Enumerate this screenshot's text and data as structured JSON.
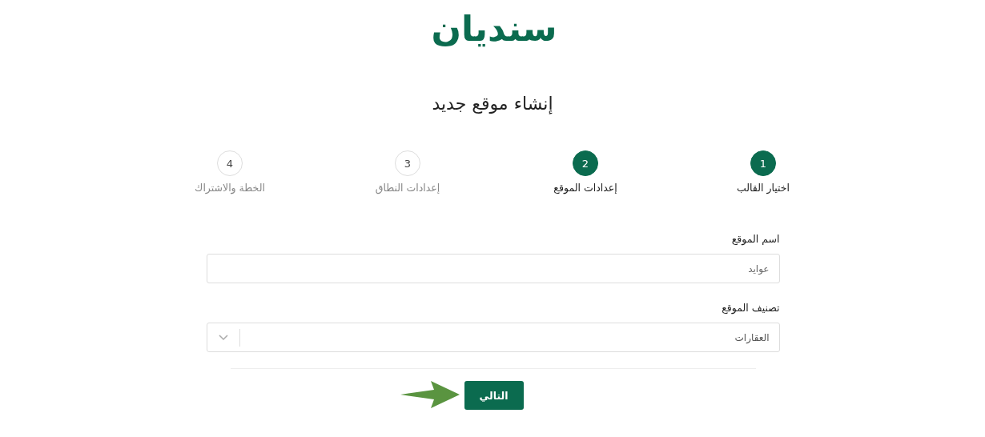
{
  "logo": {
    "text": "سنديان"
  },
  "title": "إنشاء موقع جديد",
  "steps": [
    {
      "number": "1",
      "label": "اختيار القالب",
      "active": true
    },
    {
      "number": "2",
      "label": "إعدادات الموقع",
      "active": true
    },
    {
      "number": "3",
      "label": "إعدادات النطاق",
      "active": false
    },
    {
      "number": "4",
      "label": "الخطة والاشتراك",
      "active": false
    }
  ],
  "fields": [
    {
      "kind": "text",
      "label": "اسم الموقع",
      "value": "عوايد"
    },
    {
      "kind": "select",
      "label": "تصنيف الموقع",
      "value": "العقارات"
    }
  ],
  "next_button": {
    "label": "التالي"
  }
}
